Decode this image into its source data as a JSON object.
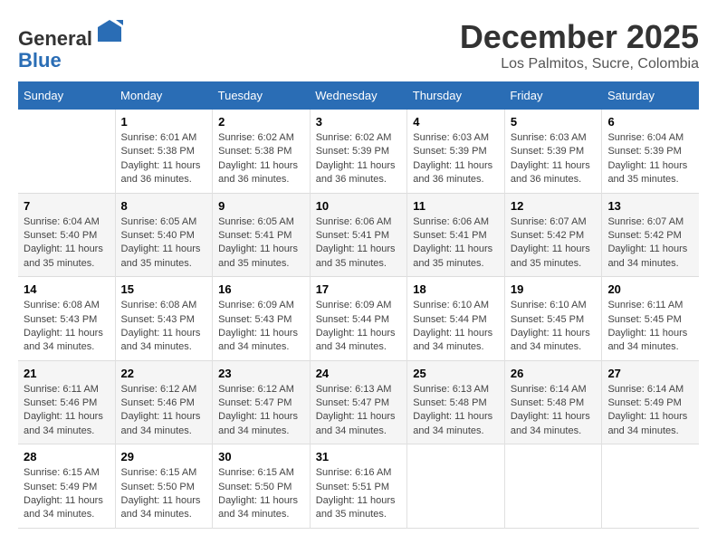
{
  "header": {
    "logo_line1": "General",
    "logo_line2": "Blue",
    "month": "December 2025",
    "location": "Los Palmitos, Sucre, Colombia"
  },
  "weekdays": [
    "Sunday",
    "Monday",
    "Tuesday",
    "Wednesday",
    "Thursday",
    "Friday",
    "Saturday"
  ],
  "weeks": [
    [
      {
        "day": "",
        "info": ""
      },
      {
        "day": "1",
        "info": "Sunrise: 6:01 AM\nSunset: 5:38 PM\nDaylight: 11 hours\nand 36 minutes."
      },
      {
        "day": "2",
        "info": "Sunrise: 6:02 AM\nSunset: 5:38 PM\nDaylight: 11 hours\nand 36 minutes."
      },
      {
        "day": "3",
        "info": "Sunrise: 6:02 AM\nSunset: 5:39 PM\nDaylight: 11 hours\nand 36 minutes."
      },
      {
        "day": "4",
        "info": "Sunrise: 6:03 AM\nSunset: 5:39 PM\nDaylight: 11 hours\nand 36 minutes."
      },
      {
        "day": "5",
        "info": "Sunrise: 6:03 AM\nSunset: 5:39 PM\nDaylight: 11 hours\nand 36 minutes."
      },
      {
        "day": "6",
        "info": "Sunrise: 6:04 AM\nSunset: 5:39 PM\nDaylight: 11 hours\nand 35 minutes."
      }
    ],
    [
      {
        "day": "7",
        "info": "Sunrise: 6:04 AM\nSunset: 5:40 PM\nDaylight: 11 hours\nand 35 minutes."
      },
      {
        "day": "8",
        "info": "Sunrise: 6:05 AM\nSunset: 5:40 PM\nDaylight: 11 hours\nand 35 minutes."
      },
      {
        "day": "9",
        "info": "Sunrise: 6:05 AM\nSunset: 5:41 PM\nDaylight: 11 hours\nand 35 minutes."
      },
      {
        "day": "10",
        "info": "Sunrise: 6:06 AM\nSunset: 5:41 PM\nDaylight: 11 hours\nand 35 minutes."
      },
      {
        "day": "11",
        "info": "Sunrise: 6:06 AM\nSunset: 5:41 PM\nDaylight: 11 hours\nand 35 minutes."
      },
      {
        "day": "12",
        "info": "Sunrise: 6:07 AM\nSunset: 5:42 PM\nDaylight: 11 hours\nand 35 minutes."
      },
      {
        "day": "13",
        "info": "Sunrise: 6:07 AM\nSunset: 5:42 PM\nDaylight: 11 hours\nand 34 minutes."
      }
    ],
    [
      {
        "day": "14",
        "info": "Sunrise: 6:08 AM\nSunset: 5:43 PM\nDaylight: 11 hours\nand 34 minutes."
      },
      {
        "day": "15",
        "info": "Sunrise: 6:08 AM\nSunset: 5:43 PM\nDaylight: 11 hours\nand 34 minutes."
      },
      {
        "day": "16",
        "info": "Sunrise: 6:09 AM\nSunset: 5:43 PM\nDaylight: 11 hours\nand 34 minutes."
      },
      {
        "day": "17",
        "info": "Sunrise: 6:09 AM\nSunset: 5:44 PM\nDaylight: 11 hours\nand 34 minutes."
      },
      {
        "day": "18",
        "info": "Sunrise: 6:10 AM\nSunset: 5:44 PM\nDaylight: 11 hours\nand 34 minutes."
      },
      {
        "day": "19",
        "info": "Sunrise: 6:10 AM\nSunset: 5:45 PM\nDaylight: 11 hours\nand 34 minutes."
      },
      {
        "day": "20",
        "info": "Sunrise: 6:11 AM\nSunset: 5:45 PM\nDaylight: 11 hours\nand 34 minutes."
      }
    ],
    [
      {
        "day": "21",
        "info": "Sunrise: 6:11 AM\nSunset: 5:46 PM\nDaylight: 11 hours\nand 34 minutes."
      },
      {
        "day": "22",
        "info": "Sunrise: 6:12 AM\nSunset: 5:46 PM\nDaylight: 11 hours\nand 34 minutes."
      },
      {
        "day": "23",
        "info": "Sunrise: 6:12 AM\nSunset: 5:47 PM\nDaylight: 11 hours\nand 34 minutes."
      },
      {
        "day": "24",
        "info": "Sunrise: 6:13 AM\nSunset: 5:47 PM\nDaylight: 11 hours\nand 34 minutes."
      },
      {
        "day": "25",
        "info": "Sunrise: 6:13 AM\nSunset: 5:48 PM\nDaylight: 11 hours\nand 34 minutes."
      },
      {
        "day": "26",
        "info": "Sunrise: 6:14 AM\nSunset: 5:48 PM\nDaylight: 11 hours\nand 34 minutes."
      },
      {
        "day": "27",
        "info": "Sunrise: 6:14 AM\nSunset: 5:49 PM\nDaylight: 11 hours\nand 34 minutes."
      }
    ],
    [
      {
        "day": "28",
        "info": "Sunrise: 6:15 AM\nSunset: 5:49 PM\nDaylight: 11 hours\nand 34 minutes."
      },
      {
        "day": "29",
        "info": "Sunrise: 6:15 AM\nSunset: 5:50 PM\nDaylight: 11 hours\nand 34 minutes."
      },
      {
        "day": "30",
        "info": "Sunrise: 6:15 AM\nSunset: 5:50 PM\nDaylight: 11 hours\nand 34 minutes."
      },
      {
        "day": "31",
        "info": "Sunrise: 6:16 AM\nSunset: 5:51 PM\nDaylight: 11 hours\nand 35 minutes."
      },
      {
        "day": "",
        "info": ""
      },
      {
        "day": "",
        "info": ""
      },
      {
        "day": "",
        "info": ""
      }
    ]
  ]
}
